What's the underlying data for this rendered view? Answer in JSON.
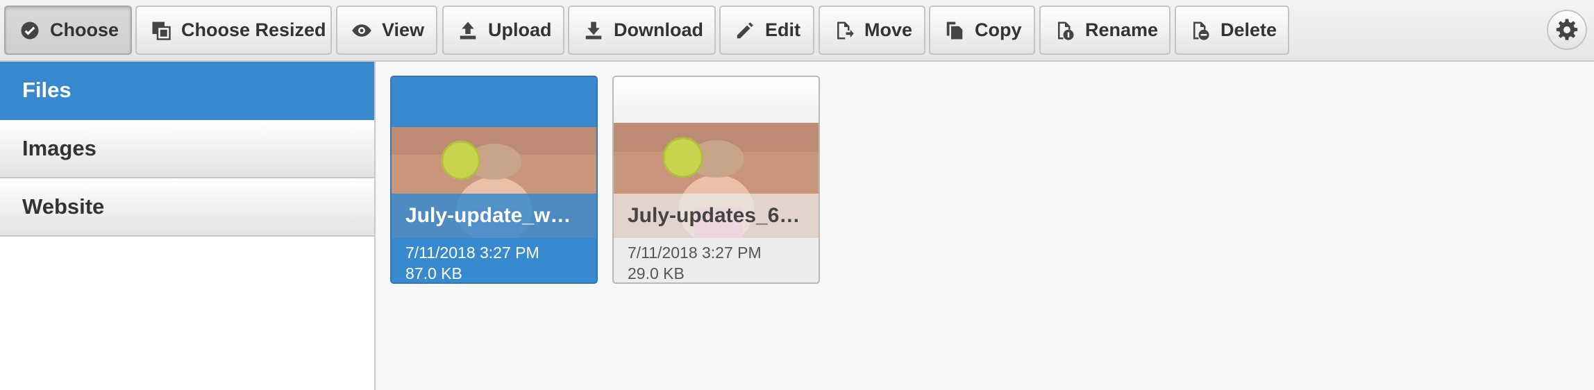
{
  "toolbar": {
    "buttons": [
      {
        "label": "Choose",
        "icon": "check-circle-icon"
      },
      {
        "label": "Choose Resized",
        "icon": "resize-icon"
      },
      {
        "label": "View",
        "icon": "eye-icon"
      },
      {
        "label": "Upload",
        "icon": "upload-icon"
      },
      {
        "label": "Download",
        "icon": "download-icon"
      },
      {
        "label": "Edit",
        "icon": "pencil-icon"
      },
      {
        "label": "Move",
        "icon": "move-file-icon"
      },
      {
        "label": "Copy",
        "icon": "copy-icon"
      },
      {
        "label": "Rename",
        "icon": "rename-file-icon"
      },
      {
        "label": "Delete",
        "icon": "delete-file-icon"
      }
    ],
    "settings_icon": "gear-icon"
  },
  "sidebar": {
    "items": [
      {
        "label": "Files",
        "active": true
      },
      {
        "label": "Images",
        "active": false
      },
      {
        "label": "Website",
        "active": false
      }
    ]
  },
  "files": [
    {
      "name": "July-update_w…",
      "date": "7/11/2018 3:27 PM",
      "size": "87.0 KB",
      "selected": true
    },
    {
      "name": "July-updates_6…",
      "date": "7/11/2018 3:27 PM",
      "size": "29.0 KB",
      "selected": false
    }
  ],
  "colors": {
    "accent": "#3889cd",
    "toolbar_bg": "#ececec",
    "text": "#333333"
  }
}
